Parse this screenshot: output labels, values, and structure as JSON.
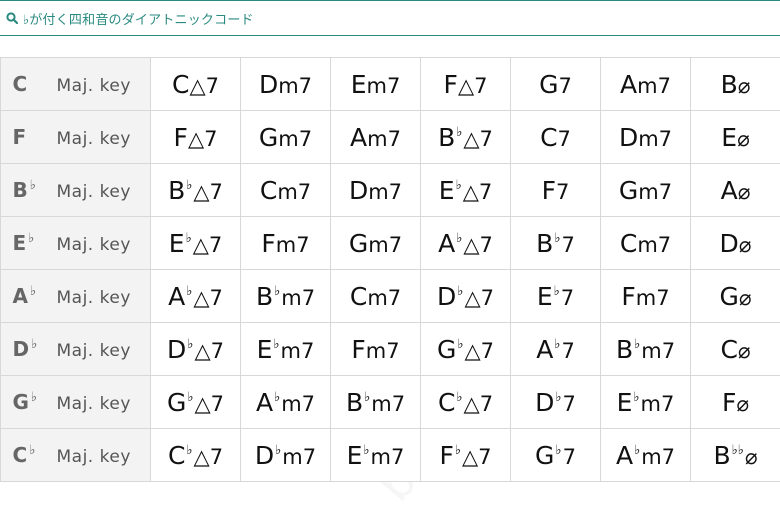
{
  "search": {
    "text": "♭が付く四和音のダイアトニックコード"
  },
  "rows": [
    {
      "key": "C",
      "key_acc": "",
      "suffix": "Maj. key",
      "chords": [
        {
          "r": "C",
          "a": "",
          "q": "△7"
        },
        {
          "r": "D",
          "a": "",
          "q": "m7"
        },
        {
          "r": "E",
          "a": "",
          "q": "m7"
        },
        {
          "r": "F",
          "a": "",
          "q": "△7"
        },
        {
          "r": "G",
          "a": "",
          "q": "7"
        },
        {
          "r": "A",
          "a": "",
          "q": "m7"
        },
        {
          "r": "B",
          "a": "",
          "q": "ø"
        }
      ]
    },
    {
      "key": "F",
      "key_acc": "",
      "suffix": "Maj. key",
      "chords": [
        {
          "r": "F",
          "a": "",
          "q": "△7"
        },
        {
          "r": "G",
          "a": "",
          "q": "m7"
        },
        {
          "r": "A",
          "a": "",
          "q": "m7"
        },
        {
          "r": "B",
          "a": "b",
          "q": "△7"
        },
        {
          "r": "C",
          "a": "",
          "q": "7"
        },
        {
          "r": "D",
          "a": "",
          "q": "m7"
        },
        {
          "r": "E",
          "a": "",
          "q": "ø"
        }
      ]
    },
    {
      "key": "B",
      "key_acc": "b",
      "suffix": "Maj. key",
      "chords": [
        {
          "r": "B",
          "a": "b",
          "q": "△7"
        },
        {
          "r": "C",
          "a": "",
          "q": "m7"
        },
        {
          "r": "D",
          "a": "",
          "q": "m7"
        },
        {
          "r": "E",
          "a": "b",
          "q": "△7"
        },
        {
          "r": "F",
          "a": "",
          "q": "7"
        },
        {
          "r": "G",
          "a": "",
          "q": "m7"
        },
        {
          "r": "A",
          "a": "",
          "q": "ø"
        }
      ]
    },
    {
      "key": "E",
      "key_acc": "b",
      "suffix": "Maj. key",
      "chords": [
        {
          "r": "E",
          "a": "b",
          "q": "△7"
        },
        {
          "r": "F",
          "a": "",
          "q": "m7"
        },
        {
          "r": "G",
          "a": "",
          "q": "m7"
        },
        {
          "r": "A",
          "a": "b",
          "q": "△7"
        },
        {
          "r": "B",
          "a": "b",
          "q": "7"
        },
        {
          "r": "C",
          "a": "",
          "q": "m7"
        },
        {
          "r": "D",
          "a": "",
          "q": "ø"
        }
      ]
    },
    {
      "key": "A",
      "key_acc": "b",
      "suffix": "Maj. key",
      "chords": [
        {
          "r": "A",
          "a": "b",
          "q": "△7"
        },
        {
          "r": "B",
          "a": "b",
          "q": "m7"
        },
        {
          "r": "C",
          "a": "",
          "q": "m7"
        },
        {
          "r": "D",
          "a": "b",
          "q": "△7"
        },
        {
          "r": "E",
          "a": "b",
          "q": "7"
        },
        {
          "r": "F",
          "a": "",
          "q": "m7"
        },
        {
          "r": "G",
          "a": "",
          "q": "ø"
        }
      ]
    },
    {
      "key": "D",
      "key_acc": "b",
      "suffix": "Maj. key",
      "chords": [
        {
          "r": "D",
          "a": "b",
          "q": "△7"
        },
        {
          "r": "E",
          "a": "b",
          "q": "m7"
        },
        {
          "r": "F",
          "a": "",
          "q": "m7"
        },
        {
          "r": "G",
          "a": "b",
          "q": "△7"
        },
        {
          "r": "A",
          "a": "b",
          "q": "7"
        },
        {
          "r": "B",
          "a": "b",
          "q": "m7"
        },
        {
          "r": "C",
          "a": "",
          "q": "ø"
        }
      ]
    },
    {
      "key": "G",
      "key_acc": "b",
      "suffix": "Maj. key",
      "chords": [
        {
          "r": "G",
          "a": "b",
          "q": "△7"
        },
        {
          "r": "A",
          "a": "b",
          "q": "m7"
        },
        {
          "r": "B",
          "a": "b",
          "q": "m7"
        },
        {
          "r": "C",
          "a": "b",
          "q": "△7"
        },
        {
          "r": "D",
          "a": "b",
          "q": "7"
        },
        {
          "r": "E",
          "a": "b",
          "q": "m7"
        },
        {
          "r": "F",
          "a": "",
          "q": "ø"
        }
      ]
    },
    {
      "key": "C",
      "key_acc": "b",
      "suffix": "Maj. key",
      "chords": [
        {
          "r": "C",
          "a": "b",
          "q": "△7"
        },
        {
          "r": "D",
          "a": "b",
          "q": "m7"
        },
        {
          "r": "E",
          "a": "b",
          "q": "m7"
        },
        {
          "r": "F",
          "a": "b",
          "q": "△7"
        },
        {
          "r": "G",
          "a": "b",
          "q": "7"
        },
        {
          "r": "A",
          "a": "b",
          "q": "m7"
        },
        {
          "r": "B",
          "a": "bb",
          "q": "ø"
        }
      ]
    }
  ],
  "watermark": "bass-beginner.com",
  "colors": {
    "accent": "#2a8a80",
    "key_bg": "#f3f3f3",
    "grid": "#d8d8d8"
  }
}
